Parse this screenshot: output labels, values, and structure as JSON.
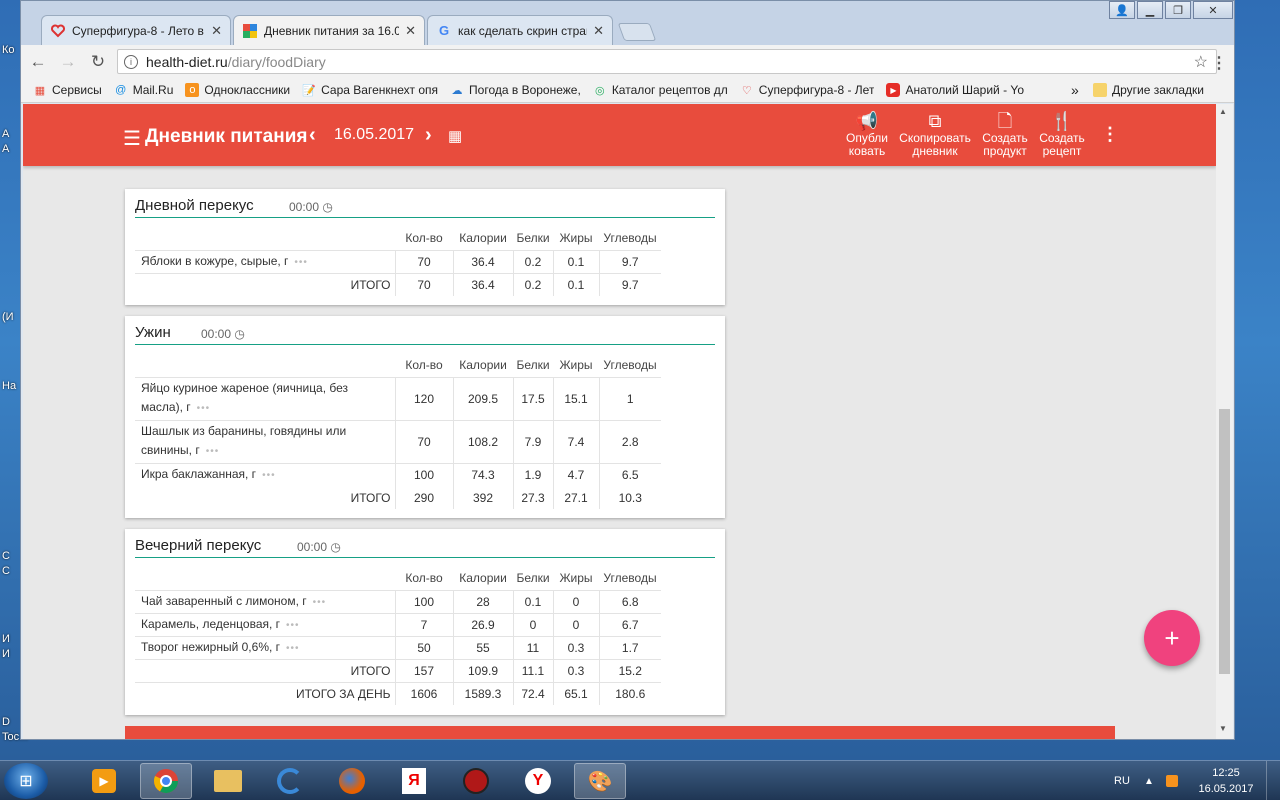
{
  "desktop": {
    "labels": [
      "Ко",
      "А",
      "А",
      "(И",
      "На",
      "С",
      "С",
      "И",
      "И",
      "D",
      "Toc..."
    ]
  },
  "browser": {
    "tabs": [
      {
        "title": "Суперфигура-8 - Лето в",
        "icon": "heart-icon",
        "active": false
      },
      {
        "title": "Дневник питания за 16.0",
        "icon": "diary-favicon",
        "active": true
      },
      {
        "title": "как сделать скрин стран",
        "icon": "google-icon",
        "active": false
      }
    ],
    "window_buttons": [
      "user-icon",
      "minimize-icon",
      "restore-icon",
      "close-icon"
    ],
    "url_host": "health-diet.ru",
    "url_path": "/diary/foodDiary",
    "bookmarks": [
      {
        "label": "Сервисы",
        "icon": "apps-icon"
      },
      {
        "label": "Mail.Ru",
        "icon": "mailru-icon"
      },
      {
        "label": "Одноклассники",
        "icon": "ok-icon"
      },
      {
        "label": "Сара Вагенкнехт опя",
        "icon": "doc-icon"
      },
      {
        "label": "Погода в Воронеже,",
        "icon": "weather-icon"
      },
      {
        "label": "Каталог рецептов дл",
        "icon": "recipes-icon"
      },
      {
        "label": "Суперфигура-8 - Лет",
        "icon": "heart-icon"
      },
      {
        "label": "Анатолий Шарий - Yo",
        "icon": "youtube-icon"
      }
    ],
    "bookmarks_more": "»",
    "other_bookmarks": "Другие закладки"
  },
  "app": {
    "title": "Дневник питания",
    "date": "16.05.2017",
    "actions": [
      {
        "label1": "Опубли",
        "label2": "ковать",
        "icon": "megaphone-icon"
      },
      {
        "label1": "Скопировать",
        "label2": "дневник",
        "icon": "copy-icon"
      },
      {
        "label1": "Создать",
        "label2": "продукт",
        "icon": "file-icon"
      },
      {
        "label1": "Создать",
        "label2": "рецепт",
        "icon": "cutlery-icon"
      }
    ],
    "fab": "+"
  },
  "columns": [
    "Кол-во",
    "Калории",
    "Белки",
    "Жиры",
    "Углеводы"
  ],
  "meals": [
    {
      "name": "Дневной перекус",
      "time": "00:00",
      "items": [
        {
          "name": "Яблоки в кожуре, сырые, г",
          "qty": "70",
          "kcal": "36.4",
          "protein": "0.2",
          "fat": "0.1",
          "carbs": "9.7"
        }
      ],
      "total": {
        "label": "ИТОГО",
        "qty": "70",
        "kcal": "36.4",
        "protein": "0.2",
        "fat": "0.1",
        "carbs": "9.7"
      }
    },
    {
      "name": "Ужин",
      "time": "00:00",
      "items": [
        {
          "name": "Яйцо куриное жареное (яичница, без масла), г",
          "qty": "120",
          "kcal": "209.5",
          "protein": "17.5",
          "fat": "15.1",
          "carbs": "1"
        },
        {
          "name": "Шашлык из баранины, говядины или свинины, г",
          "qty": "70",
          "kcal": "108.2",
          "protein": "7.9",
          "fat": "7.4",
          "carbs": "2.8"
        },
        {
          "name": "Икра баклажанная, г",
          "qty": "100",
          "kcal": "74.3",
          "protein": "1.9",
          "fat": "4.7",
          "carbs": "6.5"
        }
      ],
      "total": {
        "label": "ИТОГО",
        "qty": "290",
        "kcal": "392",
        "protein": "27.3",
        "fat": "27.1",
        "carbs": "10.3"
      }
    },
    {
      "name": "Вечерний перекус",
      "time": "00:00",
      "items": [
        {
          "name": "Чай заваренный с лимоном, г",
          "qty": "100",
          "kcal": "28",
          "protein": "0.1",
          "fat": "0",
          "carbs": "6.8"
        },
        {
          "name": "Карамель, леденцовая, г",
          "qty": "7",
          "kcal": "26.9",
          "protein": "0",
          "fat": "0",
          "carbs": "6.7"
        },
        {
          "name": "Творог нежирный 0,6%, г",
          "qty": "50",
          "kcal": "55",
          "protein": "11",
          "fat": "0.3",
          "carbs": "1.7"
        }
      ],
      "total": {
        "label": "ИТОГО",
        "qty": "157",
        "kcal": "109.9",
        "protein": "11.1",
        "fat": "0.3",
        "carbs": "15.2"
      },
      "day_total": {
        "label": "ИТОГО ЗА ДЕНЬ",
        "qty": "1606",
        "kcal": "1589.3",
        "protein": "72.4",
        "fat": "65.1",
        "carbs": "180.6"
      }
    }
  ],
  "item_menu": "•••",
  "taskbar": {
    "apps": [
      "media-player-icon",
      "chrome-icon",
      "explorer-icon",
      "ccleaner-icon",
      "firefox-icon",
      "yandex-icon",
      "spider-icon",
      "yandex-browser-icon",
      "paint-icon"
    ],
    "lang": "RU",
    "time": "12:25",
    "date": "16.05.2017"
  },
  "colors": {
    "brand": "#e84c3d",
    "accent_line": "#16a085",
    "fab": "#f0427e"
  }
}
